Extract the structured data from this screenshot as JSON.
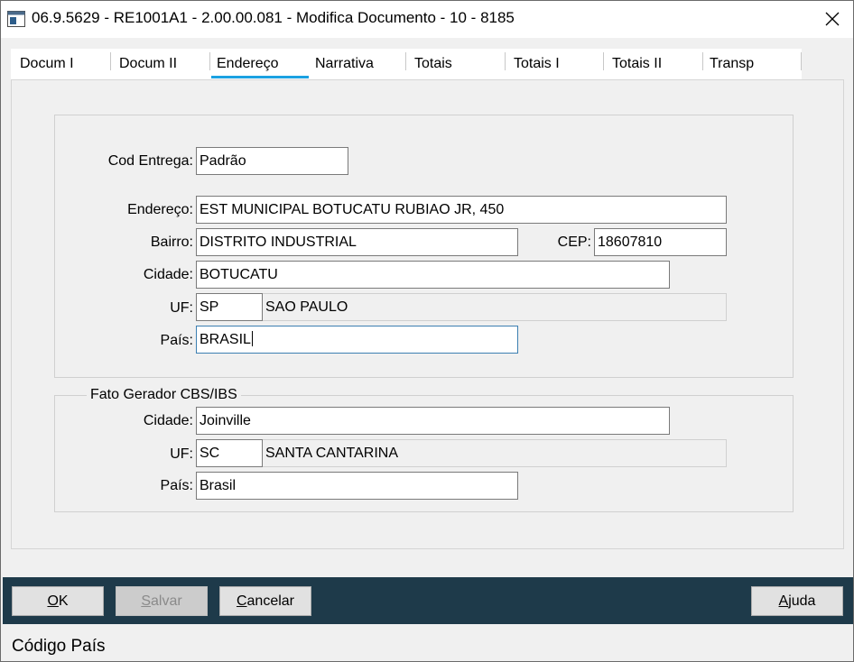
{
  "window": {
    "title": "06.9.5629 - RE1001A1 - 2.00.00.081 - Modifica Documento - 10 - 8185"
  },
  "tabs": [
    {
      "label": "Docum I"
    },
    {
      "label": "Docum II"
    },
    {
      "label": "Endereço"
    },
    {
      "label": "Narrativa"
    },
    {
      "label": "Totais"
    },
    {
      "label": "Totais I"
    },
    {
      "label": "Totais II"
    },
    {
      "label": "Transp"
    }
  ],
  "active_tab": "Endereço",
  "address": {
    "cod_entrega_label": "Cod Entrega:",
    "cod_entrega": "Padrão",
    "endereco_label": "Endereço:",
    "endereco": "EST MUNICIPAL BOTUCATU RUBIAO JR, 450",
    "bairro_label": "Bairro:",
    "bairro": "DISTRITO INDUSTRIAL",
    "cep_label": "CEP:",
    "cep": "18607810",
    "cidade_label": "Cidade:",
    "cidade": "BOTUCATU",
    "uf_label": "UF:",
    "uf": "SP",
    "uf_nome": "SAO PAULO",
    "pais_label": "País:",
    "pais": "BRASIL"
  },
  "fato_gerador": {
    "title": "Fato Gerador CBS/IBS",
    "cidade_label": "Cidade:",
    "cidade": "Joinville",
    "uf_label": "UF:",
    "uf": "SC",
    "uf_nome": "SANTA CANTARINA",
    "pais_label": "País:",
    "pais": "Brasil"
  },
  "buttons": {
    "ok_mnemonic": "O",
    "ok_rest": "K",
    "salvar_mnemonic": "S",
    "salvar_rest": "alvar",
    "cancelar_mnemonic": "C",
    "cancelar_rest": "ancelar",
    "ajuda_mnemonic": "A",
    "ajuda_rest": "juda"
  },
  "status": {
    "text": "Código País"
  },
  "colors": {
    "tab_underline": "#1ba1e2",
    "action_bar": "#1e3a4a"
  }
}
